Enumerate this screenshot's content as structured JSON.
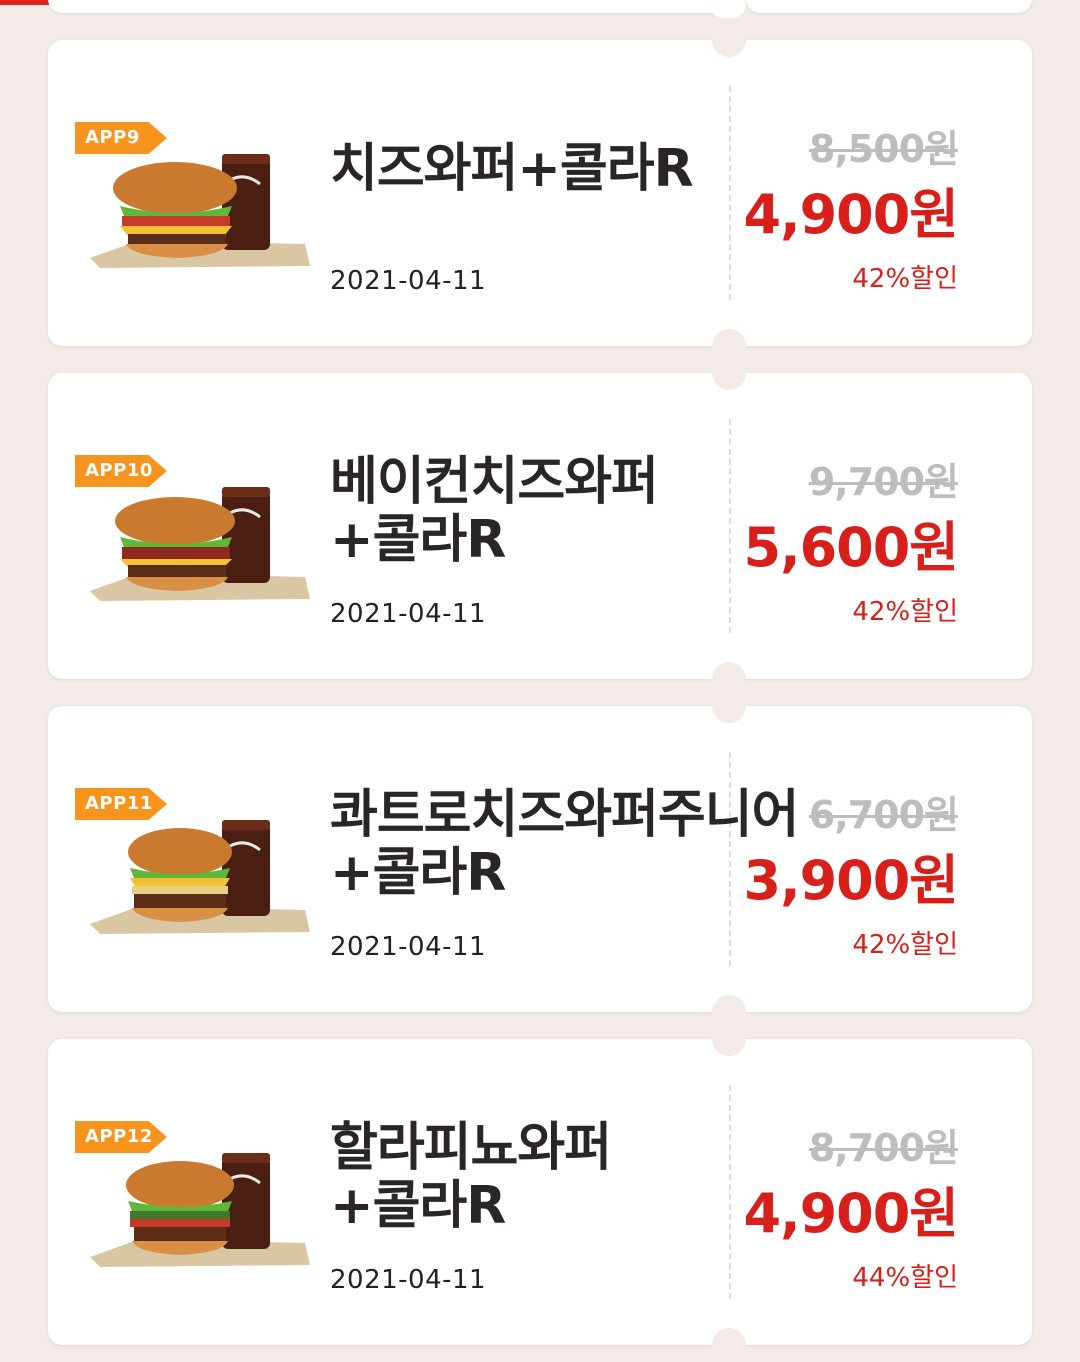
{
  "coupons": [
    {
      "badge": "APP9",
      "title": "치즈와퍼+콜라R",
      "date": "2021-04-11",
      "original_price": "8,500원",
      "price": "4,900원",
      "discount": "42%할인"
    },
    {
      "badge": "APP10",
      "title": "베이컨치즈와퍼\n+콜라R",
      "date": "2021-04-11",
      "original_price": "9,700원",
      "price": "5,600원",
      "discount": "42%할인"
    },
    {
      "badge": "APP11",
      "title": "콰트로치즈와퍼주니어\n+콜라R",
      "date": "2021-04-11",
      "original_price": "6,700원",
      "price": "3,900원",
      "discount": "42%할인"
    },
    {
      "badge": "APP12",
      "title": "할라피뇨와퍼\n+콜라R",
      "date": "2021-04-11",
      "original_price": "8,700원",
      "price": "4,900원",
      "discount": "44%할인"
    }
  ],
  "colors": {
    "accent_red": "#d81f1a",
    "badge_orange": "#f7941d",
    "background": "#f2ebe7"
  }
}
